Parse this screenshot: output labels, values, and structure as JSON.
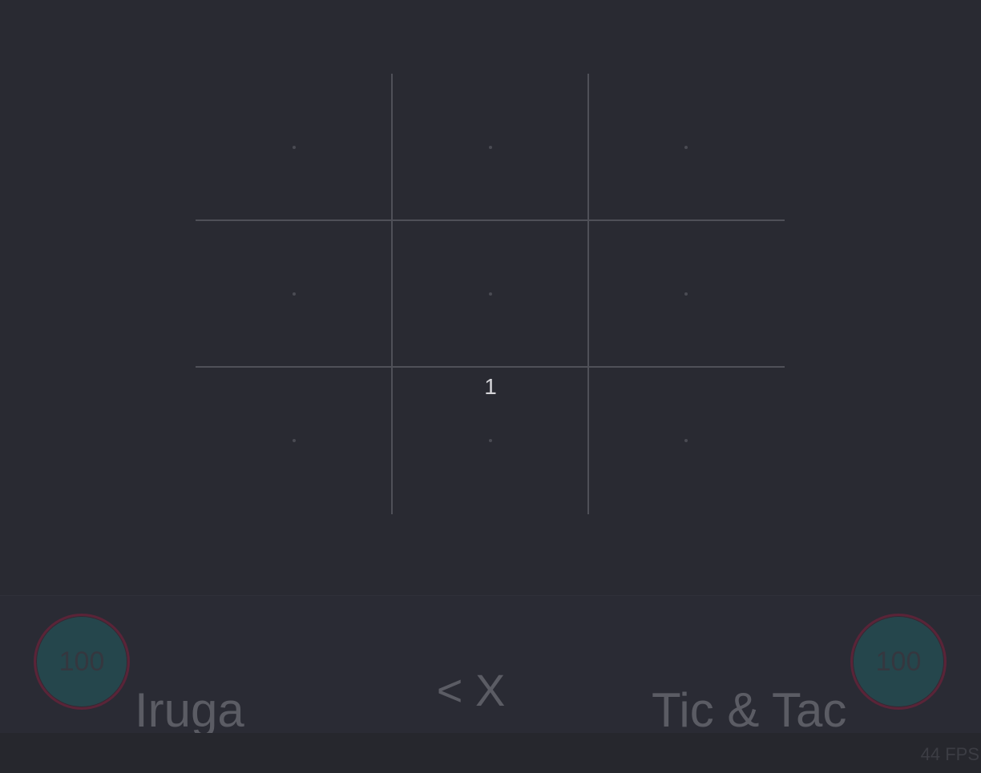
{
  "board": {
    "cells": [
      {
        "row": 0,
        "col": 0,
        "label": ""
      },
      {
        "row": 0,
        "col": 1,
        "label": ""
      },
      {
        "row": 0,
        "col": 2,
        "label": ""
      },
      {
        "row": 1,
        "col": 0,
        "label": ""
      },
      {
        "row": 1,
        "col": 1,
        "label": ""
      },
      {
        "row": 1,
        "col": 2,
        "label": ""
      },
      {
        "row": 2,
        "col": 0,
        "label": ""
      },
      {
        "row": 2,
        "col": 1,
        "label": "1"
      },
      {
        "row": 2,
        "col": 2,
        "label": ""
      }
    ]
  },
  "players": {
    "left": {
      "name": "Iruga",
      "timer": "100"
    },
    "right": {
      "name": "Tic & Tac",
      "timer": "100"
    }
  },
  "turn": {
    "indicator": "< X"
  },
  "status": {
    "fps": "44 FPS"
  },
  "colors": {
    "background": "#292a32",
    "grid": "#4f5058",
    "timer_fill": "#25464c",
    "timer_ring": "#5a2438",
    "text_dim": "#5b5c64"
  }
}
